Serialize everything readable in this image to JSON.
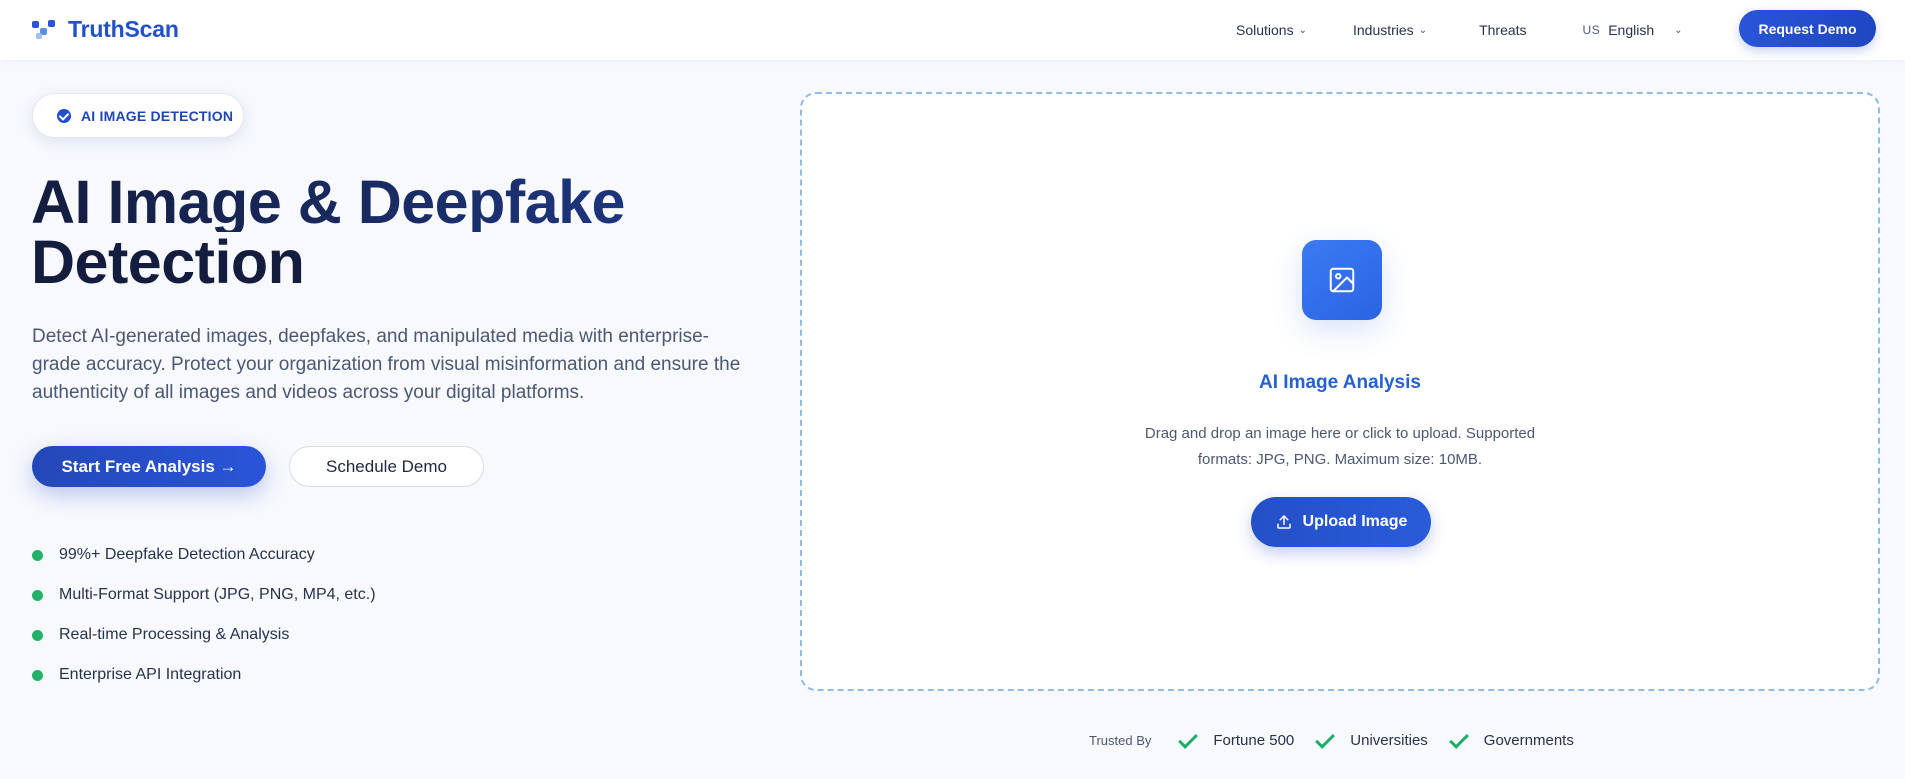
{
  "nav": {
    "brand": "TruthScan",
    "links": [
      {
        "label": "Solutions",
        "has_menu": true
      },
      {
        "label": "Industries",
        "has_menu": true
      },
      {
        "label": "Threats",
        "has_menu": false
      }
    ],
    "language": {
      "flag": "US",
      "label": "English"
    },
    "cta": "Request Demo"
  },
  "hero": {
    "badge": "AI IMAGE DETECTION",
    "title_line1": "AI Image & Deepfake",
    "title_line2": "Detection",
    "description": "Detect AI-generated images, deepfakes, and manipulated media with enterprise-grade accuracy. Protect your organization from visual misinformation and ensure the authenticity of all images and videos across your digital platforms.",
    "primary_button": "Start Free Analysis →",
    "secondary_button": "Schedule Demo",
    "features": [
      "99%+ Deepfake Detection Accuracy",
      "Multi-Format Support (JPG, PNG, MP4, etc.)",
      "Real-time Processing & Analysis",
      "Enterprise API Integration"
    ]
  },
  "upload": {
    "title": "AI Image Analysis",
    "description": "Drag and drop an image here or click to upload. Supported formats: JPG, PNG. Maximum size: 10MB.",
    "button": "Upload Image"
  },
  "trusted": {
    "label": "Trusted By",
    "items": [
      "Fortune 500",
      "Universities",
      "Governments"
    ]
  },
  "colors": {
    "brand": "#2150c8",
    "accent_green": "#22b26a",
    "upload_border": "#8fbde6"
  }
}
